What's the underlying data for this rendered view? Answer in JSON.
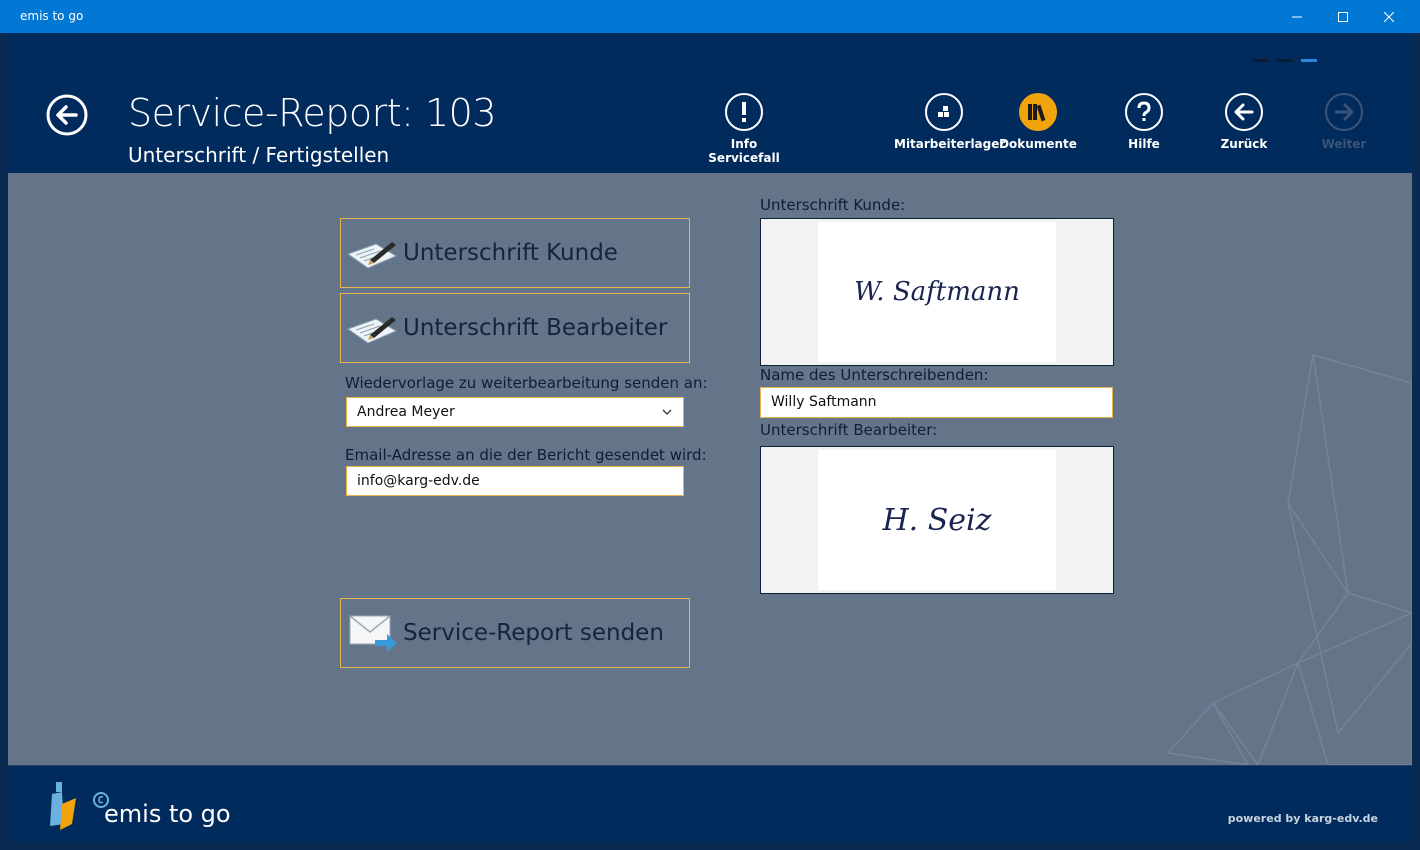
{
  "window": {
    "title": "emis to go"
  },
  "header": {
    "title": "Service-Report: 103",
    "subtitle": "Unterschrift / Fertigstellen",
    "toolbar": {
      "info": "Info Servicefall",
      "lager": "Mitarbeiterlager",
      "dokumente": "Dokumente",
      "hilfe": "Hilfe",
      "zurueck": "Zurück",
      "weiter": "Weiter"
    }
  },
  "main": {
    "sign_customer_button": "Unterschrift Kunde",
    "sign_worker_button": "Unterschrift Bearbeiter",
    "followup_label": "Wiedervorlage zu weiterbearbeitung senden an:",
    "followup_value": "Andrea Meyer",
    "email_label": "Email-Adresse an die der Bericht gesendet wird:",
    "email_value": "info@karg-edv.de",
    "send_button": "Service-Report senden",
    "customer_sig_label": "Unterschrift Kunde:",
    "customer_sig_text": "W. Saftmann",
    "signer_name_label": "Name des Unterschreibenden:",
    "signer_name_value": "Willy Saftmann",
    "worker_sig_label": "Unterschrift Bearbeiter:",
    "worker_sig_text": "H. Seiz"
  },
  "footer": {
    "brand": "emis to go",
    "powered": "powered by karg-edv.de"
  },
  "colors": {
    "accent": "#f0a30a",
    "header_bg": "#002b5c",
    "content_bg": "#647589",
    "titlebar": "#0078d4"
  }
}
